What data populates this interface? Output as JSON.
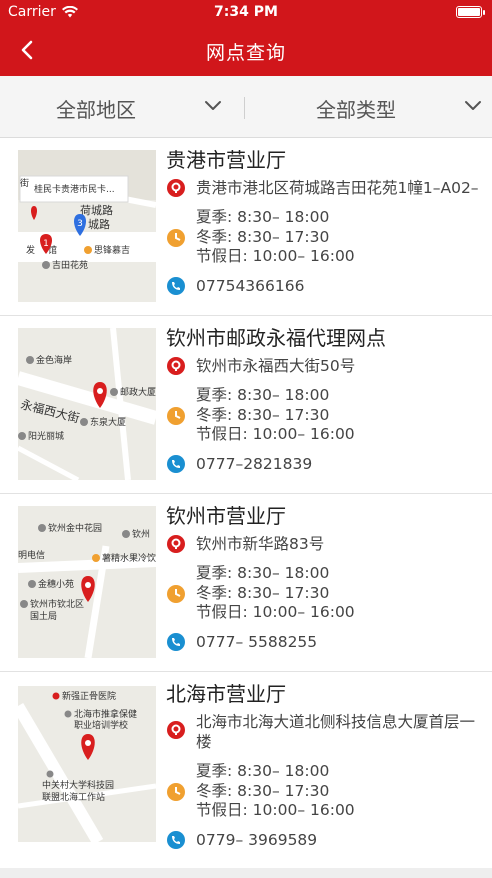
{
  "status_bar": {
    "carrier": "Carrier",
    "time": "7:34 PM"
  },
  "nav": {
    "title": "网点查询"
  },
  "filters": {
    "region": "全部地区",
    "type": "全部类型"
  },
  "colors": {
    "brand_red": "#d1161b",
    "pin_red": "#d81e1e",
    "clock_orange": "#f0a030",
    "phone_blue": "#1a8fd1"
  },
  "icons": {
    "back": "chevron-left-icon",
    "address": "location-pin-icon",
    "hours": "clock-icon",
    "phone": "phone-icon",
    "dropdown": "chevron-down-icon"
  },
  "branches": [
    {
      "name": "贵港市营业厅",
      "address": "贵港市港北区荷城路吉田花苑1幢1–A02–",
      "hours": [
        "夏季: 8:30– 18:00",
        "冬季: 8:30– 17:30",
        "节假日: 10:00– 16:00"
      ],
      "phone": "07754366166",
      "map": {
        "callout": "桂民卡贵港市民卡...",
        "labels": [
          "街",
          "荷城路",
          "城路",
          "发",
          "馆",
          "思锋慕吉",
          "吉田花苑"
        ],
        "cluster_count": "3",
        "marker_number": "1"
      }
    },
    {
      "name": "钦州市邮政永福代理网点",
      "address": "钦州市永福西大街50号",
      "hours": [
        "夏季: 8:30– 18:00",
        "冬季: 8:30– 17:30",
        "节假日: 10:00– 16:00"
      ],
      "phone": "0777–2821839",
      "map": {
        "labels": [
          "金色海岸",
          "永福西大街",
          "邮政大厦",
          "东泉大厦",
          "阳光丽城"
        ]
      }
    },
    {
      "name": "钦州市营业厅",
      "address": "钦州市新华路83号",
      "hours": [
        "夏季: 8:30– 18:00",
        "冬季: 8:30– 17:30",
        "节假日: 10:00– 16:00"
      ],
      "phone": "0777– 5588255",
      "map": {
        "labels": [
          "钦州金中花园",
          "钦州",
          "明电信",
          "薯精水果冷饮店",
          "金穗小苑",
          "钦州市钦北区",
          "国土局"
        ]
      }
    },
    {
      "name": "北海市营业厅",
      "address": "北海市北海大道北侧科技信息大厦首层一楼",
      "hours": [
        "夏季: 8:30– 18:00",
        "冬季: 8:30– 17:30",
        "节假日: 10:00– 16:00"
      ],
      "phone": "0779– 3969589",
      "map": {
        "labels": [
          "新强正骨医院",
          "北海市推拿保健",
          "职业培训学校",
          "中关村大学科技园",
          "联盟北海工作站"
        ]
      }
    }
  ]
}
